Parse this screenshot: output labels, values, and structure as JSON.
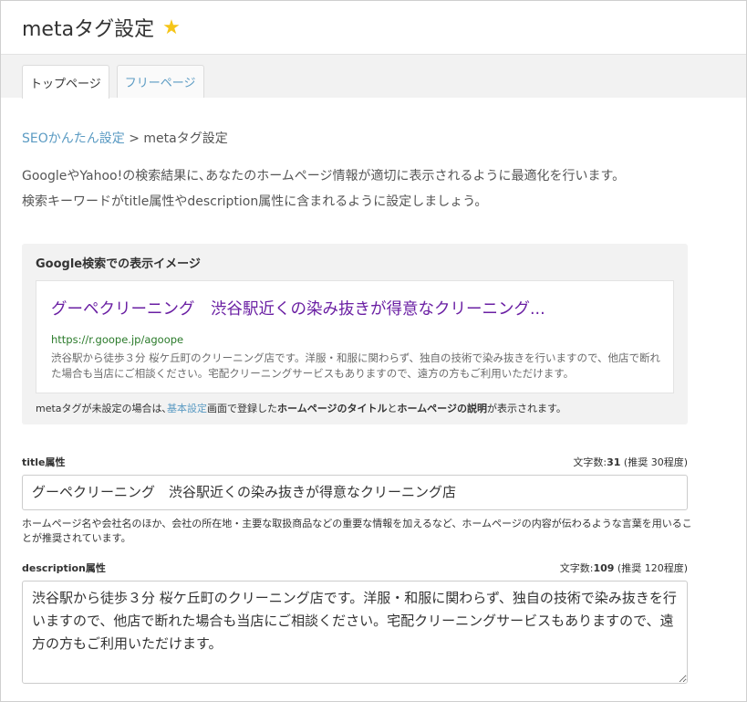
{
  "header": {
    "title": "metaタグ設定",
    "star": "★"
  },
  "tabs": [
    {
      "label": "トップページ"
    },
    {
      "label": "フリーページ"
    }
  ],
  "breadcrumb": {
    "link": "SEOかんたん設定",
    "separator": ">",
    "current": "metaタグ設定"
  },
  "intro": {
    "line1": "GoogleやYahoo!の検索結果に､あなたのホームページ情報が適切に表示されるように最適化を行います。",
    "line2": "検索キーワードがtitle属性やdescription属性に含まれるように設定しましょう。"
  },
  "preview": {
    "heading": "Google検索での表示イメージ",
    "title": "グーペクリーニング　渋谷駅近くの染み抜きが得意なクリーニング...",
    "url": "https://r.goope.jp/agoope",
    "description": "渋谷駅から徒歩３分 桜ケ丘町のクリーニング店です。洋服・和服に関わらず、独自の技術で染み抜きを行いますので、他店で断れた場合も当店にご相談ください。宅配クリーニングサービスもありますので、遠方の方もご利用いただけます。",
    "note": {
      "part1": "metaタグが未設定の場合は､",
      "link": "基本設定",
      "part2": "画面で登録した",
      "bold1": "ホームページのタイトル",
      "part3": "と",
      "bold2": "ホームページの説明",
      "part4": "が表示されます。"
    }
  },
  "title_field": {
    "label": "title属性",
    "count_prefix": "文字数:",
    "count": "31",
    "count_suffix": " (推奨 30程度)",
    "value": "グーペクリーニング　渋谷駅近くの染み抜きが得意なクリーニング店",
    "hint": "ホームページ名や会社名のほか、会社の所在地・主要な取扱商品などの重要な情報を加えるなど、ホームページの内容が伝わるような言葉を用いることが推奨されています。"
  },
  "description_field": {
    "label": "description属性",
    "count_prefix": "文字数:",
    "count": "109",
    "count_suffix": " (推奨 120程度)",
    "value": "渋谷駅から徒歩３分 桜ケ丘町のクリーニング店です。洋服・和服に関わらず、独自の技術で染み抜きを行いますので、他店で断れた場合も当店にご相談ください。宅配クリーニングサービスもありますので、遠方の方もご利用いただけます。"
  },
  "colors": {
    "link": "#5b9bc3",
    "star": "#f5c518",
    "google_title": "#6a1fa3",
    "google_url": "#2a7a2a"
  }
}
